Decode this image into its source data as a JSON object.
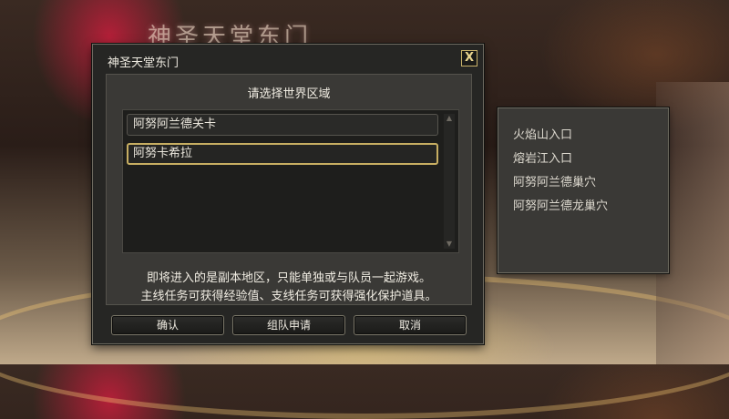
{
  "background": {
    "scene_title": "神圣天堂东门"
  },
  "dialog": {
    "title": "神圣天堂东门",
    "close_label": "X",
    "prompt": "请选择世界区域",
    "items": [
      {
        "label": "阿努阿兰德关卡",
        "selected": false
      },
      {
        "label": "阿努卡希拉",
        "selected": true
      }
    ],
    "info_lines": [
      "即将进入的是副本地区，只能单独或与队员一起游戏。",
      "主线任务可获得经验值、支线任务可获得强化保护道具。"
    ],
    "buttons": {
      "confirm": "确认",
      "party": "组队申请",
      "cancel": "取消"
    }
  },
  "side_panel": {
    "items": [
      "火焰山入口",
      "熔岩江入口",
      "阿努阿兰德巢穴",
      "阿努阿兰德龙巢穴"
    ]
  },
  "colors": {
    "accent_gold": "#c7ae62",
    "panel_bg": "#3a3936",
    "text": "#f0ece2"
  }
}
